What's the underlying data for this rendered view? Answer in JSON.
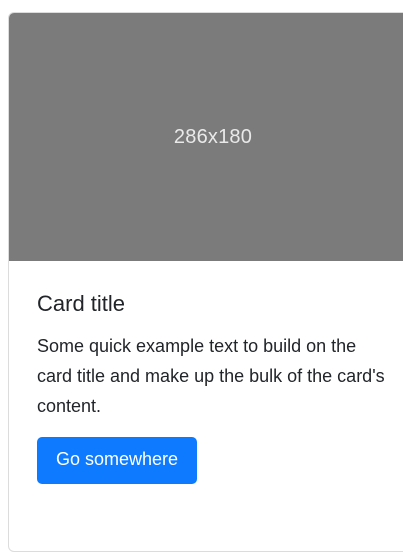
{
  "card": {
    "image_placeholder": "286x180",
    "title": "Card title",
    "text": "Some quick example text to build on the card title and make up the bulk of the card's content.",
    "button_label": "Go somewhere"
  },
  "colors": {
    "image_background": "#7b7b7b",
    "button_background": "#0d7aff",
    "text": "#212529"
  }
}
